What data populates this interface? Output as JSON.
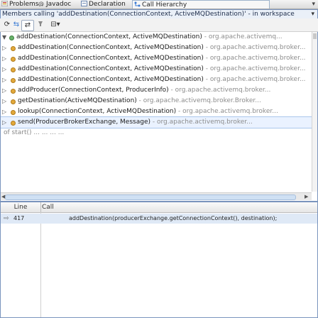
{
  "tabs": [
    {
      "label": "Problems",
      "icon": "problems-icon",
      "active": false
    },
    {
      "label": "Javadoc",
      "icon": "javadoc-icon",
      "active": false
    },
    {
      "label": "Declaration",
      "icon": "declaration-icon",
      "active": false
    },
    {
      "label": "Call Hierarchy",
      "icon": "call-hierarchy-icon",
      "active": true
    }
  ],
  "view_menu_glyph": "▾",
  "title": "Members calling 'addDestination(ConnectionContext, ActiveMQDestination)' - in workspace",
  "title_dropdown": "▾",
  "toolbar": {
    "refresh": "⟳",
    "caller": "⇆",
    "callee": "⇄",
    "history": "⊟▾"
  },
  "tree": {
    "root": {
      "method": "addDestination(ConnectionContext, ActiveMQDestination)",
      "pkg": " - org.apache.activemq..."
    },
    "children": [
      {
        "method": "addDestination(ConnectionContext, ActiveMQDestination)",
        "pkg": " - org.apache.activemq.broker..."
      },
      {
        "method": "addDestination(ConnectionContext, ActiveMQDestination)",
        "pkg": " - org.apache.activemq.broker..."
      },
      {
        "method": "addDestination(ConnectionContext, ActiveMQDestination)",
        "pkg": " - org.apache.activemq.broker..."
      },
      {
        "method": "addDestination(ConnectionContext, ActiveMQDestination)",
        "pkg": " - org.apache.activemq.broker..."
      },
      {
        "method": "addProducer(ConnectionContext, ProducerInfo)",
        "pkg": " - org.apache.activemq.broker..."
      },
      {
        "method": "getDestination(ActiveMQDestination)",
        "pkg": " - org.apache.activemq.broker.Broker..."
      },
      {
        "method": "lookup(ConnectionContext, ActiveMQDestination)",
        "pkg": " - org.apache.activemq.broker..."
      },
      {
        "method": "send(ProducerBrokerExchange, Message)",
        "pkg": " - org.apache.activemq.broker..."
      }
    ],
    "partial_row": "  of start()  ...    ...   ...   ..."
  },
  "table": {
    "headers": {
      "line": "Line",
      "call": "Call"
    },
    "rows": [
      {
        "line": "417",
        "call": "addDestination(producerExchange.getConnectionContext(), destination);"
      }
    ]
  },
  "colors": {
    "accent_border": "#7a94bd",
    "selection": "#dfe9f6",
    "method_dot": "#e2a93b"
  }
}
